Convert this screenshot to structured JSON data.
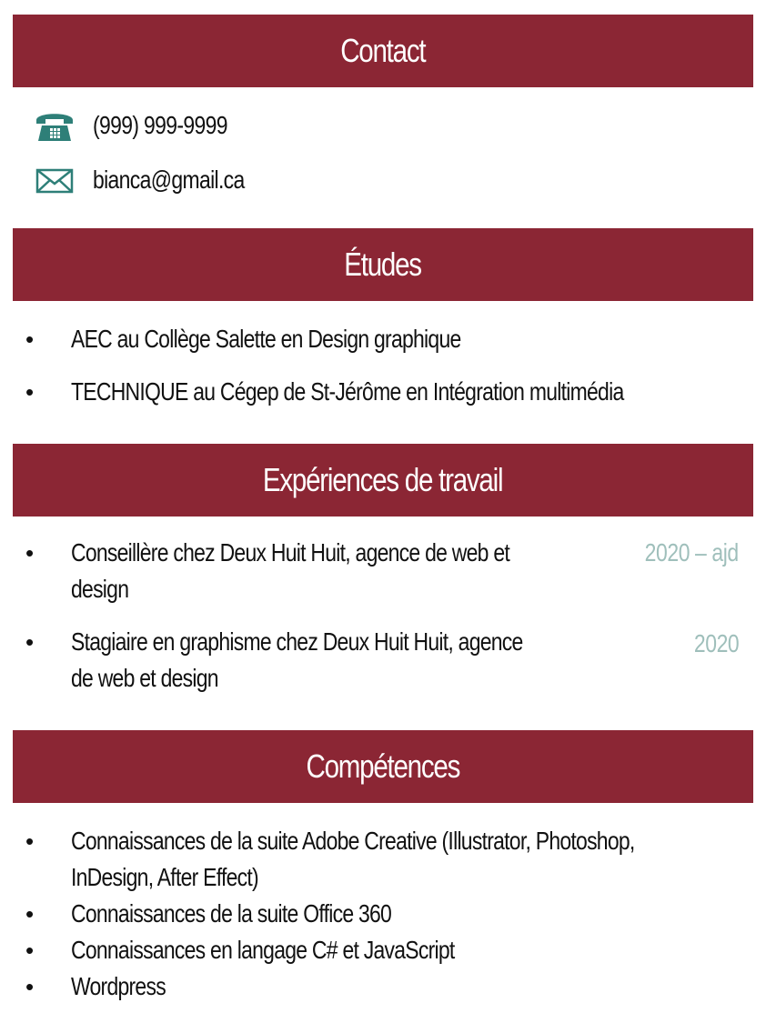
{
  "contact": {
    "title": "Contact",
    "phone": "(999) 999-9999",
    "email": "bianca@gmail.ca",
    "phone_icon": "telephone-icon",
    "email_icon": "envelope-icon"
  },
  "studies": {
    "title": "Études",
    "items": [
      "AEC au Collège Salette en Design graphique",
      "TECHNIQUE au Cégep de St-Jérôme en Intégration multimédia"
    ]
  },
  "experience": {
    "title": "Expériences de travail",
    "items": [
      {
        "line1": "Conseillère chez Deux Huit Huit, agence de web et",
        "line2": "design",
        "year": "2020 – ajd"
      },
      {
        "line1": "Stagiaire en graphisme chez Deux Huit Huit, agence",
        "line2": "de web et design",
        "year": "2020"
      }
    ]
  },
  "skills": {
    "title": "Compétences",
    "items": [
      "Connaissances de la suite Adobe Creative (Illustrator, Photoshop,",
      "InDesign, After Effect)",
      "Connaissances de la suite Office 360",
      "Connaissances en langage C# et JavaScript",
      "Wordpress"
    ]
  },
  "colors": {
    "banner": "#8b2634",
    "icon": "#2e7f78",
    "year": "#9fbfbb"
  }
}
